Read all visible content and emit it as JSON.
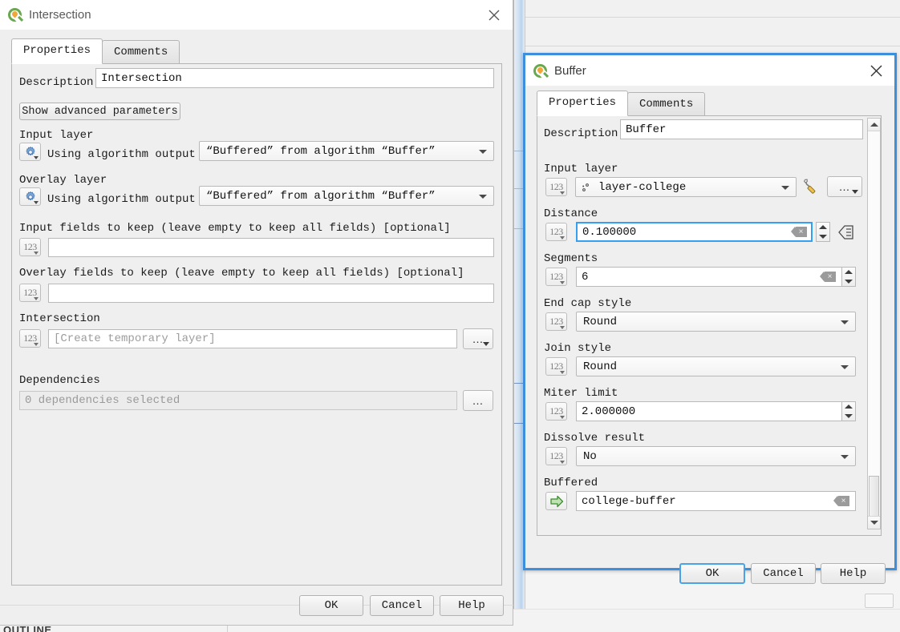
{
  "background": {
    "outline_label": "OUTLINE"
  },
  "intersection_dialog": {
    "title": "Intersection",
    "logo_icon": "qgis-logo-icon",
    "close_icon": "close-icon",
    "tabs": [
      {
        "label": "Properties",
        "selected": true
      },
      {
        "label": "Comments",
        "selected": false
      }
    ],
    "description": {
      "label": "Description",
      "value": "Intersection"
    },
    "advanced_button": "Show advanced parameters",
    "input_layer": {
      "label": "Input layer",
      "icon": "algorithm-gear-icon",
      "prefix": "Using algorithm output",
      "value": "“Buffered” from algorithm “Buffer”"
    },
    "overlay_layer": {
      "label": "Overlay layer",
      "icon": "algorithm-gear-icon",
      "prefix": "Using algorithm output",
      "value": "“Buffered” from algorithm “Buffer”"
    },
    "input_fields": {
      "label": "Input fields to keep (leave empty to keep all fields) [optional]",
      "icon": "number-variant-icon",
      "value": ""
    },
    "overlay_fields": {
      "label": "Overlay fields to keep (leave empty to keep all fields) [optional]",
      "icon": "number-variant-icon",
      "value": ""
    },
    "intersection_output": {
      "label": "Intersection",
      "icon": "number-variant-icon",
      "placeholder": "[Create temporary layer]",
      "browse_label": "…"
    },
    "dependencies": {
      "label": "Dependencies",
      "value": "0 dependencies selected",
      "browse_label": "…"
    },
    "buttons": {
      "ok": "OK",
      "cancel": "Cancel",
      "help": "Help"
    }
  },
  "buffer_dialog": {
    "title": "Buffer",
    "logo_icon": "qgis-logo-icon",
    "close_icon": "close-icon",
    "tabs": [
      {
        "label": "Properties",
        "selected": true
      },
      {
        "label": "Comments",
        "selected": false
      }
    ],
    "description": {
      "label": "Description",
      "value": "Buffer"
    },
    "input_layer": {
      "label": "Input layer",
      "icon": "number-variant-icon",
      "layer_icon": "point-layer-icon",
      "value": "layer-college",
      "wrench_icon": "wrench-icon",
      "browse_label": "…"
    },
    "distance": {
      "label": "Distance",
      "icon": "number-variant-icon",
      "value": "0.100000",
      "clear_icon": "clear-icon",
      "spinner_icon": "spinner-icon",
      "data_defined_icon": "data-defined-override-icon"
    },
    "segments": {
      "label": "Segments",
      "icon": "number-variant-icon",
      "value": "6",
      "clear_icon": "clear-icon",
      "spinner_icon": "spinner-icon"
    },
    "end_cap_style": {
      "label": "End cap style",
      "icon": "number-variant-icon",
      "value": "Round"
    },
    "join_style": {
      "label": "Join style",
      "icon": "number-variant-icon",
      "value": "Round"
    },
    "miter_limit": {
      "label": "Miter limit",
      "icon": "number-variant-icon",
      "value": "2.000000",
      "spinner_icon": "spinner-icon"
    },
    "dissolve_result": {
      "label": "Dissolve result",
      "icon": "number-variant-icon",
      "value": "No"
    },
    "buffered": {
      "label": "Buffered",
      "icon": "output-arrow-icon",
      "value": "college-buffer",
      "clear_icon": "clear-icon"
    },
    "buttons": {
      "ok": "OK",
      "cancel": "Cancel",
      "help": "Help"
    },
    "scrollbar": {
      "up_icon": "scroll-up-icon",
      "down_icon": "scroll-down-icon"
    }
  },
  "colors": {
    "accent_blue": "#3c8fdc",
    "focus_blue": "#35a0f2",
    "dialog_bg": "#efefef",
    "qgis_green": "#6aa84f",
    "qgis_orange": "#f1a63a",
    "output_green": "#4f9b3e"
  }
}
